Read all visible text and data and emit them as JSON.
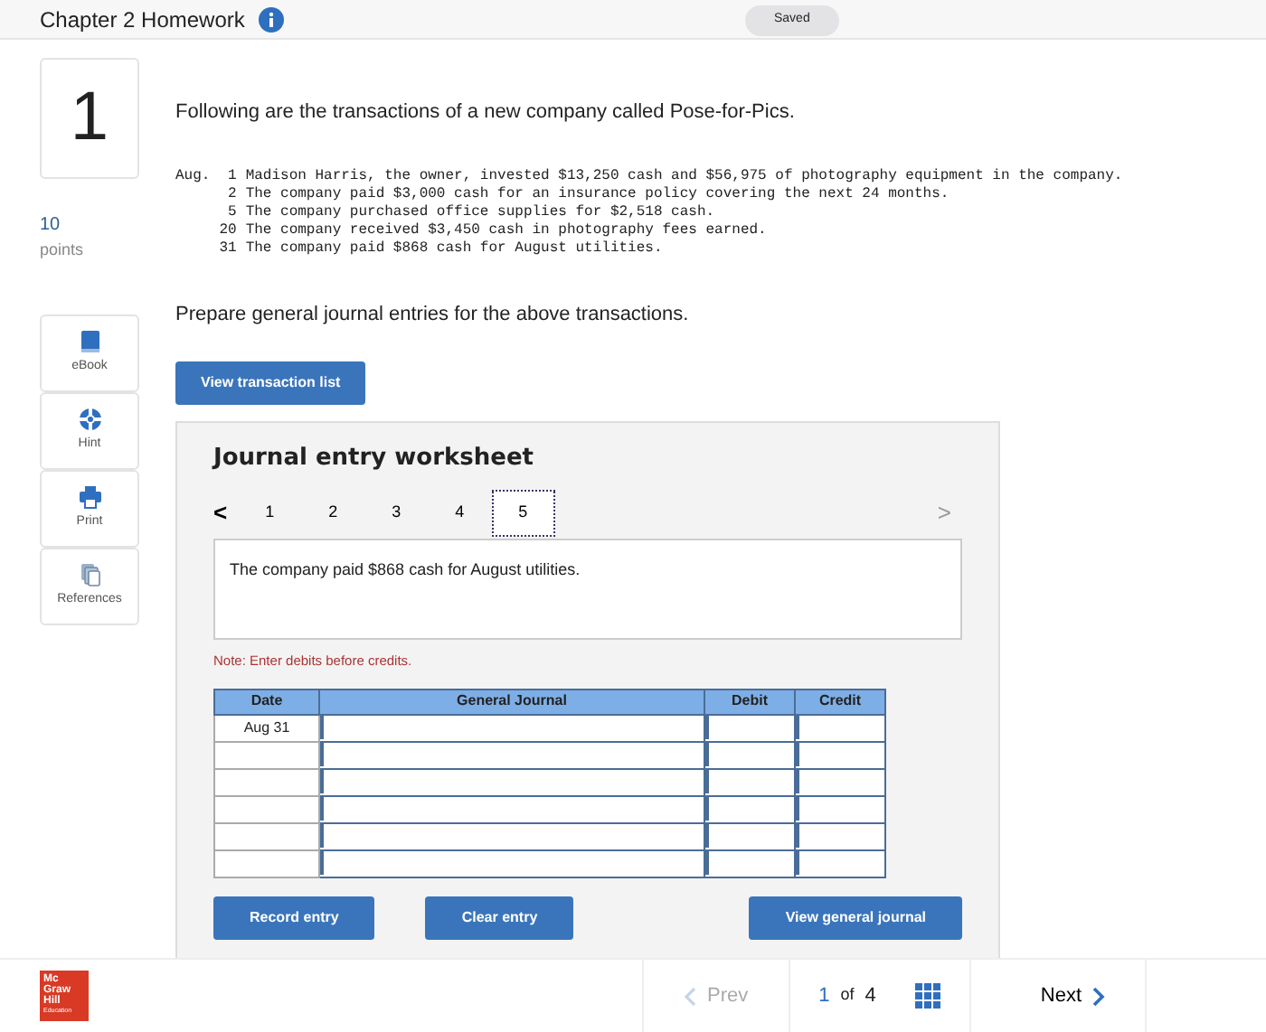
{
  "header": {
    "title": "Chapter 2 Homework",
    "status": "Saved"
  },
  "question": {
    "number": "1",
    "points": "10",
    "points_label": "points"
  },
  "tools": [
    {
      "kind": "ebook",
      "label": "eBook"
    },
    {
      "kind": "hint",
      "label": "Hint"
    },
    {
      "kind": "print",
      "label": "Print"
    },
    {
      "kind": "references",
      "label": "References"
    }
  ],
  "intro": "Following are the transactions of a new company called Pose-for-Pics.",
  "transactions": [
    {
      "month": "Aug.",
      "day": "1",
      "text": "Madison Harris, the owner, invested $13,250 cash and $56,975 of photography equipment in the company."
    },
    {
      "day": "2",
      "text": "The company paid $3,000 cash for an insurance policy covering the next 24 months."
    },
    {
      "day": "5",
      "text": "The company purchased office supplies for $2,518 cash."
    },
    {
      "day": "20",
      "text": "The company received $3,450 cash in photography fees earned."
    },
    {
      "day": "31",
      "text": "The company paid $868 cash for August utilities."
    }
  ],
  "instruction": "Prepare general journal entries for the above transactions.",
  "view_list_button": "View transaction list",
  "worksheet": {
    "title": "Journal entry worksheet",
    "prev": "<",
    "next": ">",
    "tabs": [
      {
        "label": "1",
        "selected": false
      },
      {
        "label": "2",
        "selected": false
      },
      {
        "label": "3",
        "selected": false
      },
      {
        "label": "4",
        "selected": false
      },
      {
        "label": "5",
        "selected": true
      }
    ],
    "description": "The company paid $868 cash for August utilities.",
    "note": "Note: Enter debits before credits.",
    "table": {
      "columns": [
        "Date",
        "General Journal",
        "Debit",
        "Credit"
      ],
      "rows": [
        {
          "date": "Aug 31"
        },
        {
          "date": ""
        },
        {
          "date": ""
        },
        {
          "date": ""
        },
        {
          "date": ""
        },
        {
          "date": ""
        }
      ]
    },
    "buttons": [
      "Record entry",
      "Clear entry",
      "View general journal"
    ]
  },
  "footer": {
    "logo": [
      "Mc",
      "Graw",
      "Hill",
      "Education"
    ],
    "prev": "Prev",
    "prev_disabled": true,
    "page": "1",
    "of": "of",
    "total": "4",
    "next": "Next"
  }
}
